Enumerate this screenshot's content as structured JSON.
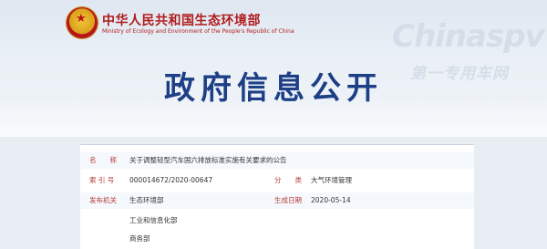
{
  "header": {
    "ministry_cn": "中华人民共和国生态环境部",
    "ministry_en": "Ministry of Ecology and Environment of the People's Republic of China",
    "brand_main": "Chinaspv",
    "brand_sub": "第一专用车网",
    "page_title": "政府信息公开"
  },
  "info": {
    "name_label": "名　　称",
    "name_value": "关于调整轻型汽车国六排放标准实施有关要求的公告",
    "index_label": "索 引 号",
    "index_value": "000014672/2020-00647",
    "category_label": "分　　类",
    "category_value": "大气环境管理",
    "issuer_label": "发布机关",
    "issuers": [
      "生态环境部",
      "工业和信息化部",
      "商务部"
    ],
    "date_label": "生成日期",
    "date_value": "2020-05-14"
  },
  "colors": {
    "title_blue": "#1d3f86",
    "ministry_red": "#b01b1b",
    "label_red": "#b5393a"
  }
}
